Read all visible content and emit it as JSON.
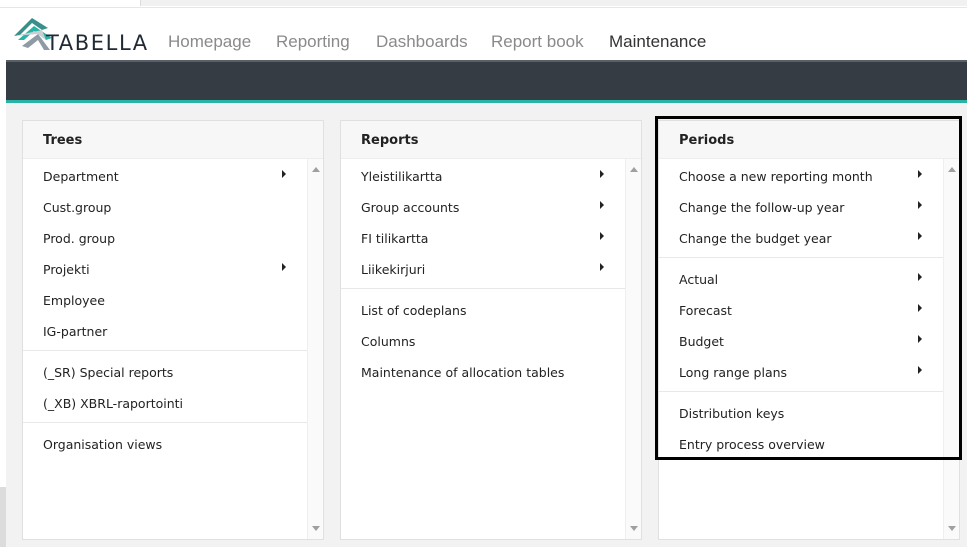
{
  "app": {
    "logo_text": "TABELLA",
    "colors": {
      "dark_bar": "#353c44",
      "accent": "#27b3a6",
      "panel_bg": "#f2f2f2"
    }
  },
  "nav": {
    "items": [
      "Homepage",
      "Reporting",
      "Dashboards",
      "Report book",
      "Maintenance"
    ],
    "active": "Maintenance"
  },
  "panels": {
    "trees": {
      "title": "Trees",
      "items": [
        {
          "label": "Department",
          "submenu": true
        },
        {
          "label": "Cust.group",
          "submenu": false
        },
        {
          "label": "Prod. group",
          "submenu": false
        },
        {
          "label": "Projekti",
          "submenu": true
        },
        {
          "label": "Employee",
          "submenu": false
        },
        {
          "label": "IG-partner",
          "submenu": false
        },
        {
          "label": "(_SR) Special reports",
          "submenu": false
        },
        {
          "label": "(_XB) XBRL-raportointi",
          "submenu": false
        },
        {
          "label": "Organisation views",
          "submenu": false
        }
      ]
    },
    "reports": {
      "title": "Reports",
      "items": [
        {
          "label": "Yleistilikartta",
          "submenu": true
        },
        {
          "label": "Group accounts",
          "submenu": true
        },
        {
          "label": "FI tilikartta",
          "submenu": true
        },
        {
          "label": "Liikekirjuri",
          "submenu": true
        },
        {
          "label": "List of codeplans",
          "submenu": false
        },
        {
          "label": "Columns",
          "submenu": false
        },
        {
          "label": "Maintenance of allocation tables",
          "submenu": false
        }
      ]
    },
    "periods": {
      "title": "Periods",
      "items": [
        {
          "label": "Choose a new reporting month",
          "submenu": true
        },
        {
          "label": "Change the follow-up year",
          "submenu": true
        },
        {
          "label": "Change the budget year",
          "submenu": true
        },
        {
          "label": "Actual",
          "submenu": true
        },
        {
          "label": "Forecast",
          "submenu": true
        },
        {
          "label": "Budget",
          "submenu": true
        },
        {
          "label": "Long range plans",
          "submenu": true
        },
        {
          "label": "Distribution keys",
          "submenu": false
        },
        {
          "label": "Entry process overview",
          "submenu": false
        }
      ]
    }
  }
}
